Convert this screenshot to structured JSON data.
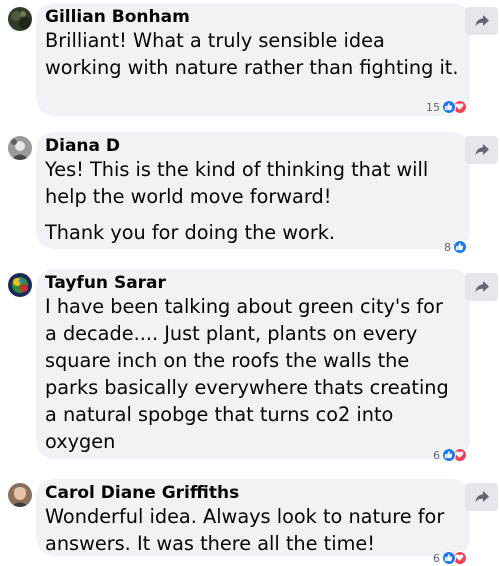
{
  "comments": [
    {
      "author": "Gillian Bonham",
      "paragraphs": [
        "Brilliant! What a truly sensible idea working with nature rather than fighting it."
      ],
      "reaction_count": "15",
      "reactions": [
        "like",
        "love"
      ],
      "avatar_icon": "avatar-photo-dark"
    },
    {
      "author": "Diana D",
      "paragraphs": [
        "Yes! This is the kind of thinking that will help the world move forward!",
        "Thank you for doing the work."
      ],
      "reaction_count": "8",
      "reactions": [
        "like"
      ],
      "avatar_icon": "avatar-photo-grey"
    },
    {
      "author": "Tayfun Sarar",
      "paragraphs": [
        "I have been talking about green city's for a decade.... Just plant, plants on every square inch on the roofs the walls the parks basically everywhere thats creating a natural spobge that turns co2 into oxygen"
      ],
      "reaction_count": "6",
      "reactions": [
        "like",
        "love"
      ],
      "avatar_icon": "avatar-photo-colorful"
    },
    {
      "author": "Carol Diane Griffiths",
      "paragraphs": [
        "Wonderful idea. Always look to nature for answers. It was there all the time!"
      ],
      "reaction_count": "6",
      "reactions": [
        "like",
        "love"
      ],
      "avatar_icon": "avatar-photo-face"
    }
  ],
  "share_icon": "share-arrow-icon",
  "colors": {
    "bubble": "#f0f2f5",
    "like": "#1877f2",
    "love": "#f33e58",
    "share_button": "#e4e6eb"
  }
}
